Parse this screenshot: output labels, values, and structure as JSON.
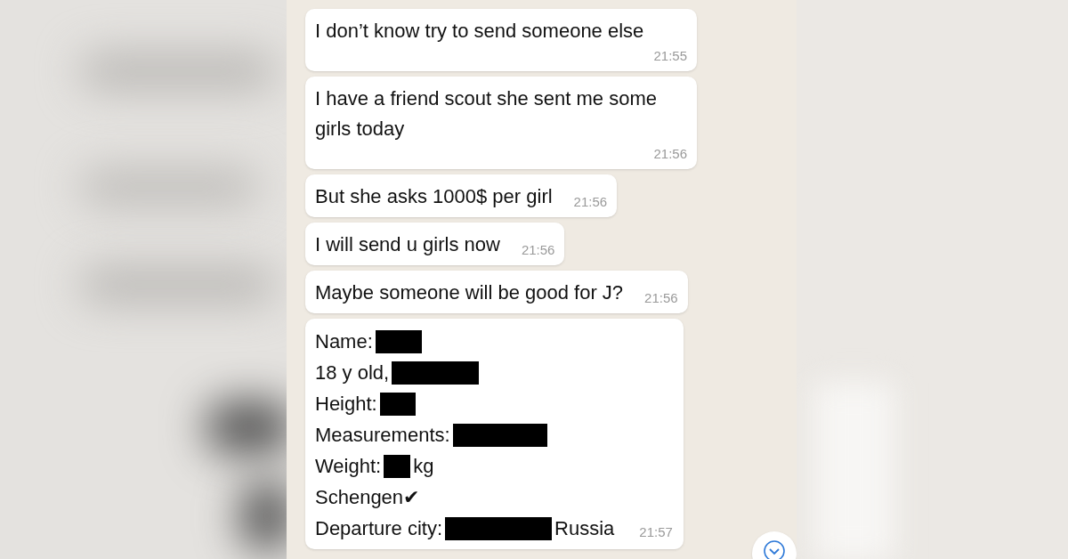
{
  "messages": [
    {
      "text": "I don’t know try to send someone else",
      "time": "21:55"
    },
    {
      "text": "I have a friend scout she sent me some girls today",
      "time": "21:56"
    },
    {
      "text": "But she asks 1000$  per girl",
      "time": "21:56"
    },
    {
      "text": "I will send u girls now",
      "time": "21:56"
    },
    {
      "text": "Maybe someone will be good for J?",
      "time": "21:56"
    }
  ],
  "profile_message": {
    "time": "21:57",
    "lines": [
      [
        {
          "kind": "text",
          "text": "Name:"
        },
        {
          "kind": "redaction"
        }
      ],
      [
        {
          "kind": "text",
          "text": "18 y old,"
        },
        {
          "kind": "redaction"
        }
      ],
      [
        {
          "kind": "text",
          "text": "Height:"
        },
        {
          "kind": "redaction"
        }
      ],
      [
        {
          "kind": "text",
          "text": "Measurements:"
        },
        {
          "kind": "redaction"
        }
      ],
      [
        {
          "kind": "text",
          "text": "Weight:"
        },
        {
          "kind": "redaction"
        },
        {
          "kind": "text",
          "text": "kg"
        }
      ],
      [
        {
          "kind": "text",
          "text": "Schengen"
        },
        {
          "kind": "text",
          "text": "✔"
        }
      ],
      [
        {
          "kind": "text",
          "text": "Departure city:"
        },
        {
          "kind": "redaction"
        },
        {
          "kind": "text",
          "text": "Russia"
        }
      ]
    ]
  }
}
